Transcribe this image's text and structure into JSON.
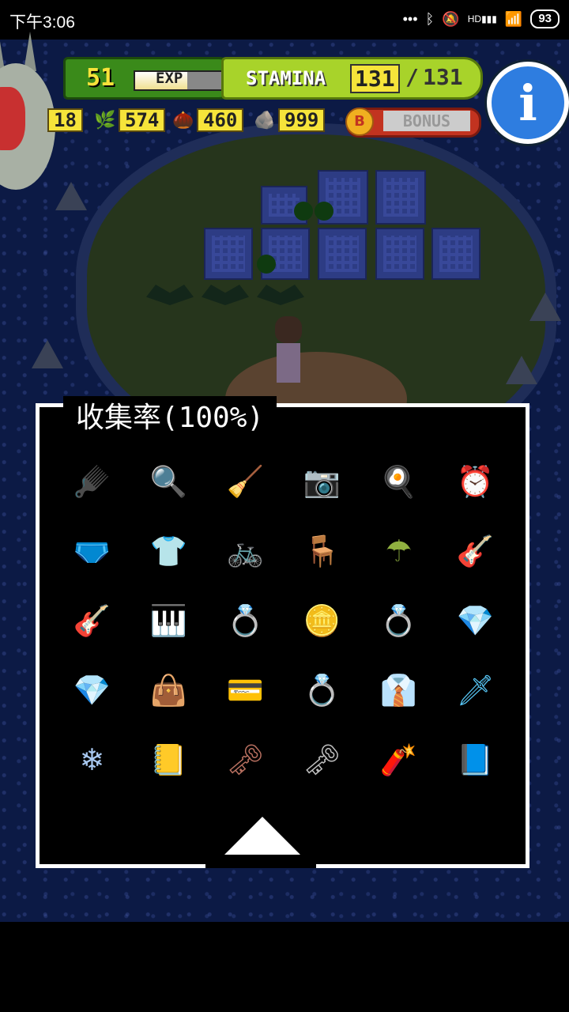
{
  "status_bar": {
    "time": "下午3:06",
    "icons": [
      "more-dots-icon",
      "bluetooth-icon",
      "mute-icon",
      "signal-icon",
      "wifi-icon"
    ],
    "signal_label": "HD",
    "battery": "93"
  },
  "hud": {
    "level": "51",
    "exp_label": "EXP",
    "exp_fill": 0.6,
    "stamina_label": "STAMINA",
    "stamina_current": "131",
    "stamina_sep": "/",
    "stamina_max": "131",
    "resources": [
      {
        "icon": "character-icon",
        "value": "18"
      },
      {
        "icon": "leaf-icon",
        "value": "574"
      },
      {
        "icon": "nut-icon",
        "value": "460"
      },
      {
        "icon": "stone-icon",
        "value": "999"
      }
    ],
    "bonus_badge": "B",
    "bonus_label": "BONUS"
  },
  "info_button": {
    "label": "i"
  },
  "collection": {
    "title": "收集率(100%)",
    "items": [
      {
        "name": "comb-icon",
        "glyph": "🪮",
        "color": "#cfd8e8"
      },
      {
        "name": "magnifier-icon",
        "glyph": "🔍",
        "color": "#d8b060"
      },
      {
        "name": "vacuum-icon",
        "glyph": "🧹",
        "color": "#c8704a"
      },
      {
        "name": "camera-icon",
        "glyph": "📷",
        "color": "#b8b8b8"
      },
      {
        "name": "frying-pan-icon",
        "glyph": "🍳",
        "color": "#7888a0"
      },
      {
        "name": "clock-icon",
        "glyph": "⏰",
        "color": "#4878d8"
      },
      {
        "name": "underwear-icon",
        "glyph": "🩲",
        "color": "#f080b0"
      },
      {
        "name": "shirt-icon",
        "glyph": "👕",
        "color": "#c8c0b0"
      },
      {
        "name": "bicycle-icon",
        "glyph": "🚲",
        "color": "#e03040"
      },
      {
        "name": "folding-chair-icon",
        "glyph": "🪑",
        "color": "#6888c8"
      },
      {
        "name": "umbrella-icon",
        "glyph": "☂",
        "color": "#90b040"
      },
      {
        "name": "electric-guitar-icon",
        "glyph": "🎸",
        "color": "#e03838"
      },
      {
        "name": "guitar-icon",
        "glyph": "🎸",
        "color": "#d08860"
      },
      {
        "name": "piano-icon",
        "glyph": "🎹",
        "color": "#e85070"
      },
      {
        "name": "ring-icon",
        "glyph": "💍",
        "color": "#e0a020"
      },
      {
        "name": "coin-icon",
        "glyph": "🪙",
        "color": "#f0b030"
      },
      {
        "name": "silver-ring-icon",
        "glyph": "💍",
        "color": "#c0c0c8"
      },
      {
        "name": "gem-icon",
        "glyph": "💎",
        "color": "#e84870"
      },
      {
        "name": "crystal-icon",
        "glyph": "💎",
        "color": "#40c060"
      },
      {
        "name": "handbag-icon",
        "glyph": "👜",
        "color": "#d83028"
      },
      {
        "name": "credit-card-icon",
        "glyph": "💳",
        "color": "#4878c8"
      },
      {
        "name": "gold-ring-icon",
        "glyph": "💍",
        "color": "#e8b040"
      },
      {
        "name": "outfit-icon",
        "glyph": "👔",
        "color": "#f0e8c0"
      },
      {
        "name": "lightsaber-icon",
        "glyph": "🗡",
        "color": "#58c8f8"
      },
      {
        "name": "ice-crystal-icon",
        "glyph": "❄",
        "color": "#a8c8f0"
      },
      {
        "name": "golden-book-icon",
        "glyph": "📒",
        "color": "#e0a020"
      },
      {
        "name": "bronze-key-icon",
        "glyph": "🗝",
        "color": "#b87060"
      },
      {
        "name": "silver-key-icon",
        "glyph": "🗝",
        "color": "#c0c0c0"
      },
      {
        "name": "dynamite-icon",
        "glyph": "🧨",
        "color": "#e03838"
      },
      {
        "name": "blue-book-icon",
        "glyph": "📘",
        "color": "#3878c8"
      }
    ],
    "scroll_up": "scroll-up-arrow-icon"
  }
}
